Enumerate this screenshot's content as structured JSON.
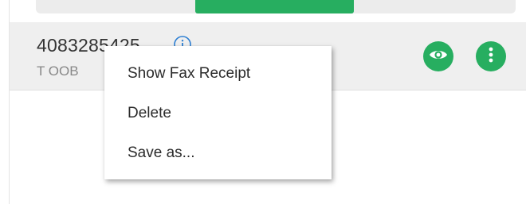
{
  "progress": {
    "fraction": 0.33,
    "start_fraction": 0.333,
    "color": "#27ae60"
  },
  "fax": {
    "number": "4083285425",
    "subtitle": "T OOB"
  },
  "icons": {
    "info": "info-circle-icon",
    "view": "eye-icon",
    "more": "more-vertical-icon"
  },
  "colors": {
    "accent": "#27ae60",
    "info": "#2d7fd3",
    "row_bg": "#efefef"
  },
  "context_menu": {
    "items": [
      {
        "label": "Show Fax Receipt"
      },
      {
        "label": "Delete"
      },
      {
        "label": "Save as..."
      }
    ]
  }
}
